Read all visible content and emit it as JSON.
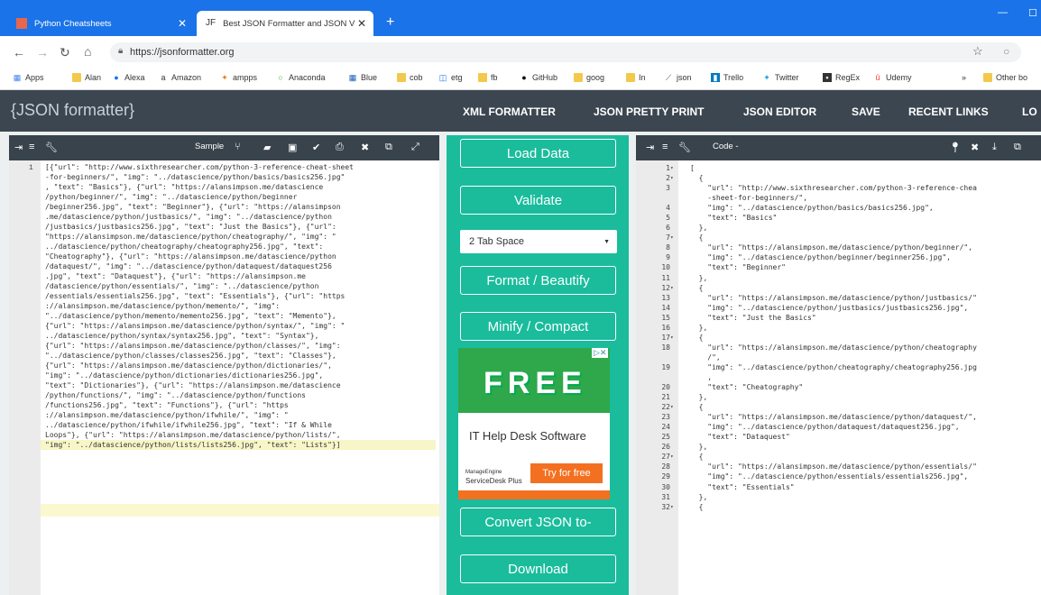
{
  "browser": {
    "tabs": [
      {
        "title": "Python Cheatsheets",
        "close": "✕"
      },
      {
        "title": "Best JSON Formatter and JSON V",
        "close": "✕",
        "favicon": "JF"
      }
    ],
    "new_tab": "+",
    "url": "https://jsonformatter.org",
    "bookmarks": [
      "Apps",
      "Alan",
      "Alexa",
      "Amazon",
      "ampps",
      "Anaconda",
      "Blue",
      "cob",
      "etg",
      "fb",
      "GitHub",
      "goog",
      "In",
      "json",
      "Trello",
      "Twitter",
      "RegEx",
      "Udemy",
      "»",
      "Other bo"
    ]
  },
  "site": {
    "logo": "{JSON formatter}",
    "nav": [
      "XML FORMATTER",
      "JSON PRETTY PRINT",
      "JSON EDITOR",
      "SAVE",
      "RECENT LINKS",
      "LO"
    ]
  },
  "left_toolbar": {
    "sample": "Sample"
  },
  "left_editor": {
    "line_number": "1",
    "lines": [
      "[{\"url\": \"http://www.sixthresearcher.com/python-3-reference-cheat-sheet",
      "-for-beginners/\", \"img\": \"../datascience/python/basics/basics256.jpg\"",
      ", \"text\": \"Basics\"}, {\"url\": \"https://alansimpson.me/datascience",
      "/python/beginner/\", \"img\": \"../datascience/python/beginner",
      "/beginner256.jpg\", \"text\": \"Beginner\"}, {\"url\": \"https://alansimpson",
      ".me/datascience/python/justbasics/\", \"img\": \"../datascience/python",
      "/justbasics/justbasics256.jpg\", \"text\": \"Just the Basics\"}, {\"url\":",
      "\"https://alansimpson.me/datascience/python/cheatography/\", \"img\": \"",
      "../datascience/python/cheatography/cheatography256.jpg\", \"text\":",
      "\"Cheatography\"}, {\"url\": \"https://alansimpson.me/datascience/python",
      "/dataquest/\", \"img\": \"../datascience/python/dataquest/dataquest256",
      ".jpg\", \"text\": \"Dataquest\"}, {\"url\": \"https://alansimpson.me",
      "/datascience/python/essentials/\", \"img\": \"../datascience/python",
      "/essentials/essentials256.jpg\", \"text\": \"Essentials\"}, {\"url\": \"https",
      "://alansimpson.me/datascience/python/memento/\", \"img\":",
      "\"../datascience/python/memento/memento256.jpg\", \"text\": \"Memento\"},",
      "{\"url\": \"https://alansimpson.me/datascience/python/syntax/\", \"img\": \"",
      "../datascience/python/syntax/syntax256.jpg\", \"text\": \"Syntax\"},",
      "{\"url\": \"https://alansimpson.me/datascience/python/classes/\", \"img\":",
      "\"../datascience/python/classes/classes256.jpg\", \"text\": \"Classes\"},",
      "{\"url\": \"https://alansimpson.me/datascience/python/dictionaries/\",",
      "\"img\": \"../datascience/python/dictionaries/dictionaries256.jpg\",",
      "\"text\": \"Dictionaries\"}, {\"url\": \"https://alansimpson.me/datascience",
      "/python/functions/\", \"img\": \"../datascience/python/functions",
      "/functions256.jpg\", \"text\": \"Functions\"}, {\"url\": \"https",
      "://alansimpson.me/datascience/python/ifwhile/\", \"img\": \"",
      "../datascience/python/ifwhile/ifwhile256.jpg\", \"text\": \"If & While",
      "Loops\"}, {\"url\": \"https://alansimpson.me/datascience/python/lists/\",",
      "\"img\": \"../datascience/python/lists/lists256.jpg\", \"text\": \"Lists\"}]"
    ]
  },
  "middle": {
    "load_data": "Load Data",
    "validate": "Validate",
    "tab_space": "2 Tab Space",
    "format": "Format / Beautify",
    "minify": "Minify / Compact",
    "convert": "Convert JSON to-",
    "download": "Download"
  },
  "ad": {
    "free": "FREE",
    "title": "IT Help Desk Software",
    "brand_line1": "ManageEngine",
    "brand_line2": "ServiceDesk Plus",
    "cta": "Try for free"
  },
  "right_toolbar": {
    "mode": "Code -"
  },
  "right_editor": {
    "rows": [
      {
        "n": "1",
        "f": "▾",
        "t": "["
      },
      {
        "n": "2",
        "f": "▾",
        "t": "  {"
      },
      {
        "n": "3",
        "f": "",
        "t": "    \"url\": \"http://www.sixthresearcher.com/python-3-reference-chea"
      },
      {
        "n": "",
        "f": "",
        "t": "    -sheet-for-beginners/\","
      },
      {
        "n": "4",
        "f": "",
        "t": "    \"img\": \"../datascience/python/basics/basics256.jpg\","
      },
      {
        "n": "5",
        "f": "",
        "t": "    \"text\": \"Basics\""
      },
      {
        "n": "6",
        "f": "",
        "t": "  },"
      },
      {
        "n": "7",
        "f": "▾",
        "t": "  {"
      },
      {
        "n": "8",
        "f": "",
        "t": "    \"url\": \"https://alansimpson.me/datascience/python/beginner/\","
      },
      {
        "n": "9",
        "f": "",
        "t": "    \"img\": \"../datascience/python/beginner/beginner256.jpg\","
      },
      {
        "n": "10",
        "f": "",
        "t": "    \"text\": \"Beginner\""
      },
      {
        "n": "11",
        "f": "",
        "t": "  },"
      },
      {
        "n": "12",
        "f": "▾",
        "t": "  {"
      },
      {
        "n": "13",
        "f": "",
        "t": "    \"url\": \"https://alansimpson.me/datascience/python/justbasics/\""
      },
      {
        "n": "14",
        "f": "",
        "t": "    \"img\": \"../datascience/python/justbasics/justbasics256.jpg\","
      },
      {
        "n": "15",
        "f": "",
        "t": "    \"text\": \"Just the Basics\""
      },
      {
        "n": "16",
        "f": "",
        "t": "  },"
      },
      {
        "n": "17",
        "f": "▾",
        "t": "  {"
      },
      {
        "n": "18",
        "f": "",
        "t": "    \"url\": \"https://alansimpson.me/datascience/python/cheatography"
      },
      {
        "n": "",
        "f": "",
        "t": "    /\","
      },
      {
        "n": "19",
        "f": "",
        "t": "    \"img\": \"../datascience/python/cheatography/cheatography256.jpg"
      },
      {
        "n": "",
        "f": "",
        "t": "    ,"
      },
      {
        "n": "20",
        "f": "",
        "t": "    \"text\": \"Cheatography\""
      },
      {
        "n": "21",
        "f": "",
        "t": "  },"
      },
      {
        "n": "22",
        "f": "▾",
        "t": "  {"
      },
      {
        "n": "23",
        "f": "",
        "t": "    \"url\": \"https://alansimpson.me/datascience/python/dataquest/\","
      },
      {
        "n": "24",
        "f": "",
        "t": "    \"img\": \"../datascience/python/dataquest/dataquest256.jpg\","
      },
      {
        "n": "25",
        "f": "",
        "t": "    \"text\": \"Dataquest\""
      },
      {
        "n": "26",
        "f": "",
        "t": "  },"
      },
      {
        "n": "27",
        "f": "▾",
        "t": "  {"
      },
      {
        "n": "28",
        "f": "",
        "t": "    \"url\": \"https://alansimpson.me/datascience/python/essentials/\""
      },
      {
        "n": "29",
        "f": "",
        "t": "    \"img\": \"../datascience/python/essentials/essentials256.jpg\","
      },
      {
        "n": "30",
        "f": "",
        "t": "    \"text\": \"Essentials\""
      },
      {
        "n": "31",
        "f": "",
        "t": "  },"
      },
      {
        "n": "32",
        "f": "▾",
        "t": "  {"
      }
    ]
  }
}
